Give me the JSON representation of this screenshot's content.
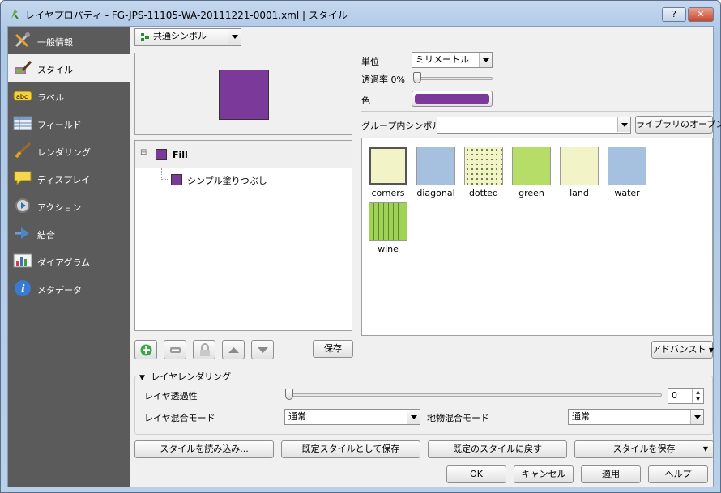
{
  "window": {
    "title": "レイヤプロパティ - FG-JPS-11105-WA-20111221-0001.xml | スタイル",
    "help_label": "?",
    "close_label": "✕"
  },
  "sidebar": {
    "items": [
      {
        "label": "一般情報",
        "icon": "tools-icon"
      },
      {
        "label": "スタイル",
        "icon": "style-brush-icon"
      },
      {
        "label": "ラベル",
        "icon": "abc-label-icon"
      },
      {
        "label": "フィールド",
        "icon": "table-icon"
      },
      {
        "label": "レンダリング",
        "icon": "paintbrush-icon"
      },
      {
        "label": "ディスプレイ",
        "icon": "speech-bubble-icon"
      },
      {
        "label": "アクション",
        "icon": "gear-action-icon"
      },
      {
        "label": "結合",
        "icon": "join-arrow-icon"
      },
      {
        "label": "ダイアグラム",
        "icon": "diagram-icon"
      },
      {
        "label": "メタデータ",
        "icon": "info-icon"
      }
    ],
    "active_index": 1
  },
  "renderer": {
    "selected": "共通シンボル"
  },
  "symbol": {
    "fill_color": "#7b3a9a",
    "tree_root": "Fill",
    "tree_child": "シンプル塗りつぶし",
    "save_label": "保存"
  },
  "properties": {
    "unit_label": "単位",
    "unit_value": "ミリメートル",
    "transparency_label": "透過率 0%",
    "transparency_value": 0,
    "color_label": "色",
    "color_value": "#7b3a9a"
  },
  "library": {
    "group_label": "グループ内シンボル",
    "group_value": "",
    "open_library_label": "ライブラリのオープン",
    "advanced_label": "アドバンスト",
    "symbols": [
      {
        "name": "corners",
        "color": "#f2f4c8"
      },
      {
        "name": "diagonal",
        "color": "#a6c0df"
      },
      {
        "name": "dotted",
        "color": "#f2f4c8"
      },
      {
        "name": "green",
        "color": "#b7dd69"
      },
      {
        "name": "land",
        "color": "#f2f4c8"
      },
      {
        "name": "water",
        "color": "#a6c0df"
      },
      {
        "name": "wine",
        "color": "#9fd256"
      }
    ]
  },
  "layer_rendering": {
    "title": "レイヤレンダリング",
    "transparency_label": "レイヤ透過性",
    "transparency_value": "0",
    "blend_label": "レイヤ混合モード",
    "blend_value": "通常",
    "feature_blend_label": "地物混合モード",
    "feature_blend_value": "通常"
  },
  "bottom": {
    "load_style": "スタイルを読み込み...",
    "save_default": "既定スタイルとして保存",
    "restore_default": "既定のスタイルに戻す",
    "save_style": "スタイルを保存",
    "ok": "OK",
    "cancel": "キャンセル",
    "apply": "適用",
    "help": "ヘルプ"
  }
}
